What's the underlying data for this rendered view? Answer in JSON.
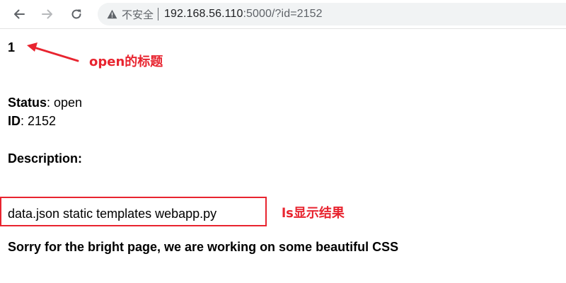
{
  "browser": {
    "icons": [
      "back-arrow-icon",
      "forward-arrow-icon",
      "reload-icon",
      "warning-icon"
    ],
    "security_label": "不安全",
    "url_host": "192.168.56.110",
    "url_rest": ":5000/?id=2152"
  },
  "page": {
    "title": "1",
    "status_label": "Status",
    "status_value": ": open",
    "id_label": "ID",
    "id_value": ": 2152",
    "description_heading": "Description:",
    "result_text": "data.json static templates webapp.py",
    "sorry_text": "Sorry for the bright page, we are working on some beautiful CSS"
  },
  "annotations": {
    "title_note": "open的标题",
    "ls_note": "ls显示结果",
    "accent_color": "#e8242f"
  }
}
